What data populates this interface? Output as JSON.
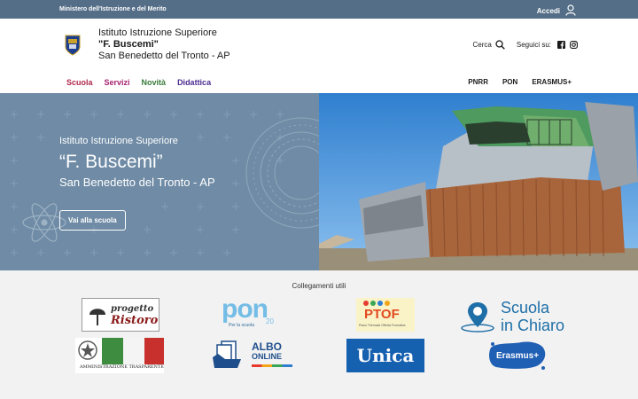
{
  "topbar": {
    "ministry": "Ministero dell'Istruzione e del Merito",
    "login": "Accedi"
  },
  "header": {
    "line1": "Istituto Istruzione Superiore",
    "line2": "\"F. Buscemi\"",
    "line3": "San Benedetto del Tronto - AP",
    "search_label": "Cerca",
    "follow_label": "Seguici su:"
  },
  "nav": {
    "items": [
      {
        "label": "Scuola",
        "color": "#b0284b"
      },
      {
        "label": "Servizi",
        "color": "#a6226e"
      },
      {
        "label": "Novità",
        "color": "#3a7a3a"
      },
      {
        "label": "Didattica",
        "color": "#4b2b8f"
      }
    ],
    "right": [
      "PNRR",
      "PON",
      "ERASMUS+"
    ]
  },
  "hero": {
    "line1": "Istituto Istruzione Superiore",
    "line2": "“F. Buscemi”",
    "line3": "San Benedetto del Tronto - AP",
    "button": "Vai alla scuola"
  },
  "links": {
    "title": "Collegamenti utili",
    "cards": [
      {
        "name": "progetto-ristoro",
        "lines": [
          "progetto",
          "Ristoro"
        ]
      },
      {
        "name": "pon",
        "lines": [
          "pon",
          "Per la scuola",
          "20"
        ]
      },
      {
        "name": "ptof",
        "lines": [
          "PTOF",
          "Piano Triennale Offerta Formativa"
        ]
      },
      {
        "name": "scuola-in-chiaro",
        "lines": [
          "Scuola",
          "in Chiaro"
        ]
      },
      {
        "name": "amministrazione-trasparente",
        "lines": [
          "AMMINISTRAZIONE TRASPARENTE"
        ]
      },
      {
        "name": "albo-online",
        "lines": [
          "ALBO",
          "ONLINE"
        ]
      },
      {
        "name": "unica",
        "lines": [
          "Unica"
        ]
      },
      {
        "name": "erasmus",
        "lines": [
          "Erasmus+"
        ]
      }
    ]
  },
  "colors": {
    "topbar": "#546e87",
    "hero_left": "#6f8ba5",
    "background": "#f2f2f2"
  }
}
